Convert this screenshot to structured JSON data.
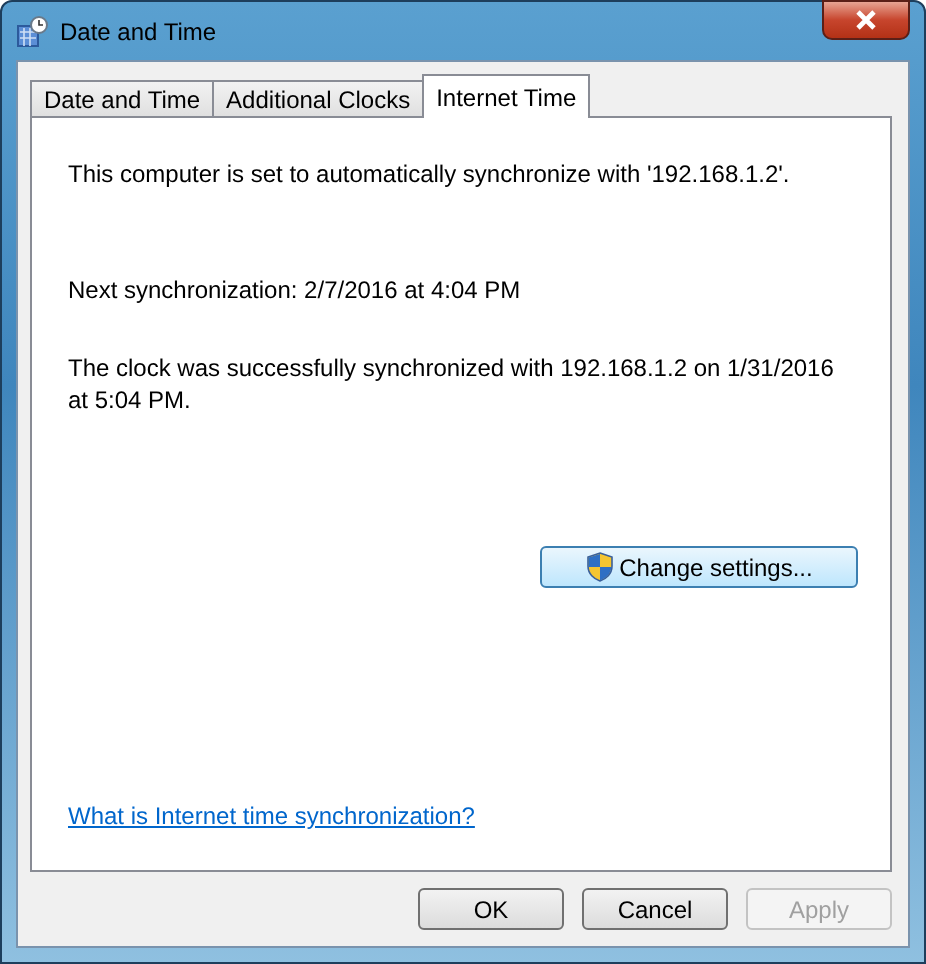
{
  "window": {
    "title": "Date and Time"
  },
  "tabs": [
    {
      "label": "Date and Time",
      "selected": false
    },
    {
      "label": "Additional Clocks",
      "selected": false
    },
    {
      "label": "Internet Time",
      "selected": true
    }
  ],
  "status_text": "This computer is set to automatically synchronize with '192.168.1.2'.",
  "next_sync": "Next synchronization: 2/7/2016 at 4:04 PM",
  "last_sync": "The clock was successfully synchronized with 192.168.1.2 on 1/31/2016 at 5:04 PM.",
  "change_settings_button": {
    "label": "Change settings..."
  },
  "help_link": "What is Internet time synchronization?",
  "buttons": [
    {
      "label": "OK",
      "disabled": false
    },
    {
      "label": "Cancel",
      "disabled": false
    },
    {
      "label": "Apply",
      "disabled": true
    }
  ]
}
